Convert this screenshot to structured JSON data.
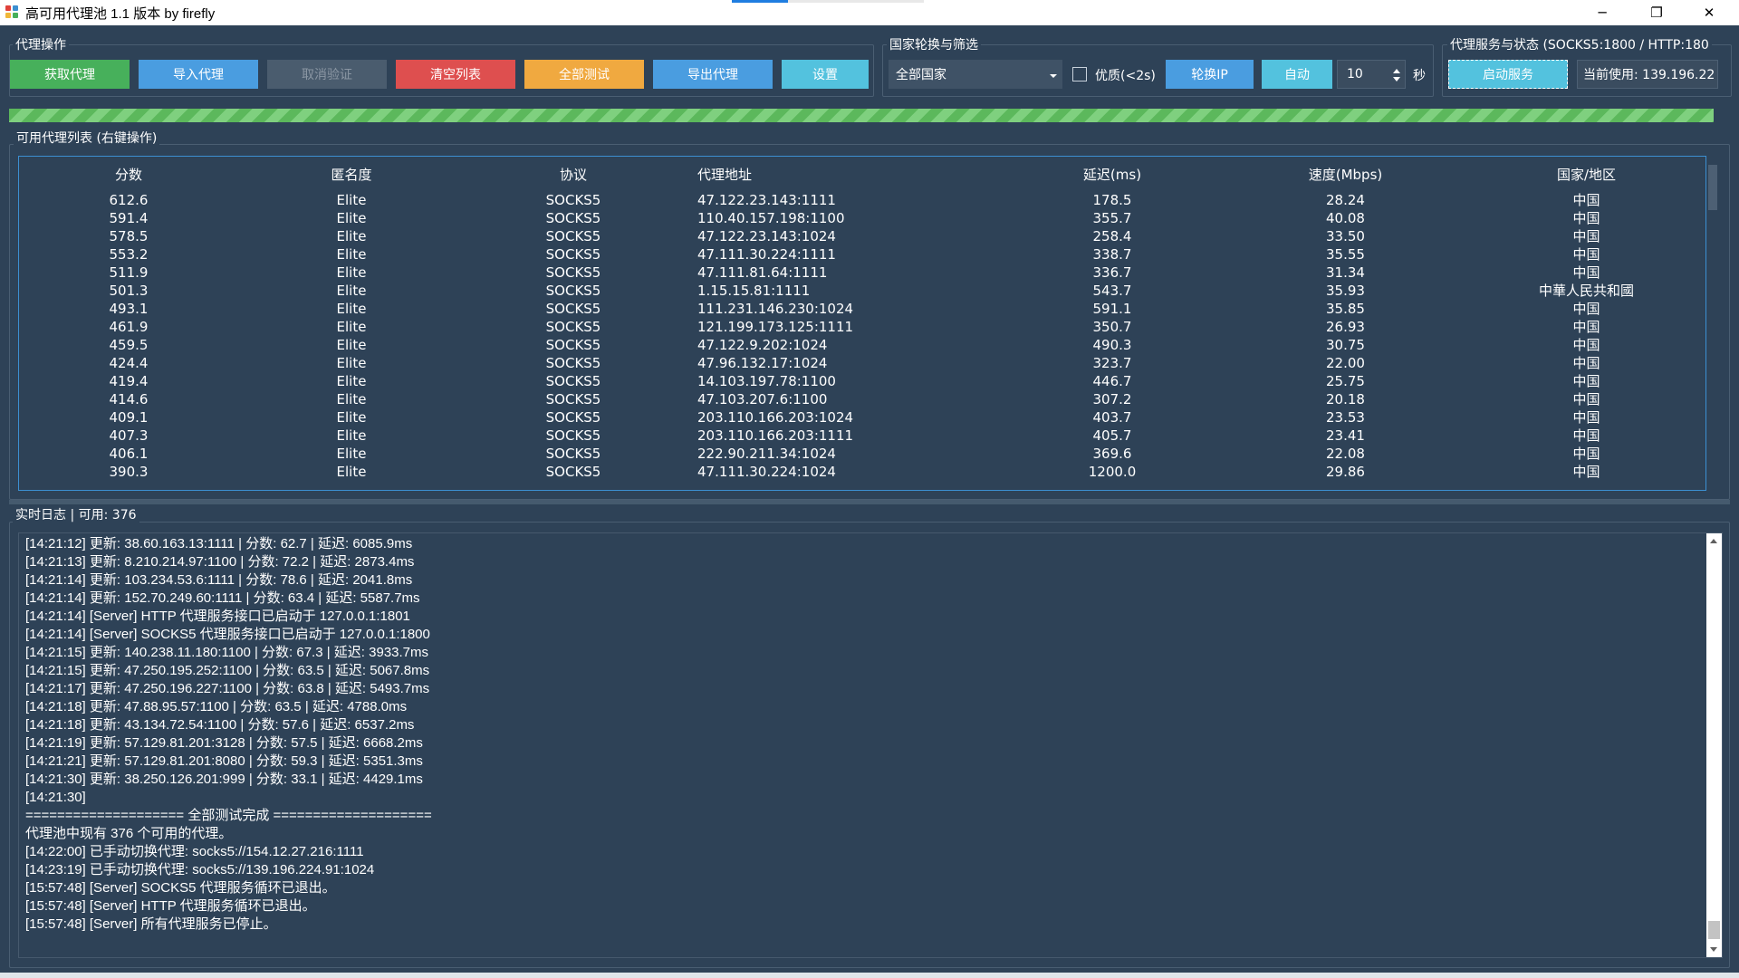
{
  "window": {
    "title": "高可用代理池 1.1 版本 by firefly",
    "minimize": "─",
    "restore": "❐",
    "close": "✕"
  },
  "proxy_ops": {
    "title": "代理操作",
    "buttons": [
      {
        "label": "获取代理",
        "color": "#47b05b"
      },
      {
        "label": "导入代理",
        "color": "#4a9de0"
      },
      {
        "label": "取消验证",
        "color": "#4a5c6e"
      },
      {
        "label": "清空列表",
        "color": "#de4f4f"
      },
      {
        "label": "全部测试",
        "color": "#f0a940"
      },
      {
        "label": "导出代理",
        "color": "#4a9de0"
      },
      {
        "label": "设置",
        "color": "#53c2de"
      }
    ]
  },
  "country": {
    "title": "国家轮换与筛选",
    "selected": "全部国家",
    "quality_label": "优质(<2s)",
    "rotate_label": "轮换IP",
    "auto_label": "自动",
    "interval_value": "10",
    "interval_unit": "秒"
  },
  "service": {
    "title": "代理服务与状态 (SOCKS5:1800 / HTTP:180",
    "start_label": "启动服务",
    "current_label": "当前使用: 139.196.22"
  },
  "progress": {
    "value_percent": 100
  },
  "proxy_table": {
    "title": "可用代理列表 (右键操作)",
    "columns": [
      "分数",
      "匿名度",
      "协议",
      "代理地址",
      "延迟(ms)",
      "速度(Mbps)",
      "国家/地区"
    ],
    "rows": [
      [
        "612.6",
        "Elite",
        "SOCKS5",
        "47.122.23.143:1111",
        "178.5",
        "28.24",
        "中国"
      ],
      [
        "591.4",
        "Elite",
        "SOCKS5",
        "110.40.157.198:1100",
        "355.7",
        "40.08",
        "中国"
      ],
      [
        "578.5",
        "Elite",
        "SOCKS5",
        "47.122.23.143:1024",
        "258.4",
        "33.50",
        "中国"
      ],
      [
        "553.2",
        "Elite",
        "SOCKS5",
        "47.111.30.224:1111",
        "338.7",
        "35.55",
        "中国"
      ],
      [
        "511.9",
        "Elite",
        "SOCKS5",
        "47.111.81.64:1111",
        "336.7",
        "31.34",
        "中国"
      ],
      [
        "501.3",
        "Elite",
        "SOCKS5",
        "1.15.15.81:1111",
        "543.7",
        "35.93",
        "中華人民共和國"
      ],
      [
        "493.1",
        "Elite",
        "SOCKS5",
        "111.231.146.230:1024",
        "591.1",
        "35.85",
        "中国"
      ],
      [
        "461.9",
        "Elite",
        "SOCKS5",
        "121.199.173.125:1111",
        "350.7",
        "26.93",
        "中国"
      ],
      [
        "459.5",
        "Elite",
        "SOCKS5",
        "47.122.9.202:1024",
        "490.3",
        "30.75",
        "中国"
      ],
      [
        "424.4",
        "Elite",
        "SOCKS5",
        "47.96.132.17:1024",
        "323.7",
        "22.00",
        "中国"
      ],
      [
        "419.4",
        "Elite",
        "SOCKS5",
        "14.103.197.78:1100",
        "446.7",
        "25.75",
        "中国"
      ],
      [
        "414.6",
        "Elite",
        "SOCKS5",
        "47.103.207.6:1100",
        "307.2",
        "20.18",
        "中国"
      ],
      [
        "409.1",
        "Elite",
        "SOCKS5",
        "203.110.166.203:1024",
        "403.7",
        "23.53",
        "中国"
      ],
      [
        "407.3",
        "Elite",
        "SOCKS5",
        "203.110.166.203:1111",
        "405.7",
        "23.41",
        "中国"
      ],
      [
        "406.1",
        "Elite",
        "SOCKS5",
        "222.90.211.34:1024",
        "369.6",
        "22.08",
        "中国"
      ],
      [
        "390.3",
        "Elite",
        "SOCKS5",
        "47.111.30.224:1024",
        "1200.0",
        "29.86",
        "中国"
      ]
    ]
  },
  "log": {
    "title": "实时日志 | 可用: 376",
    "lines": [
      "[14:21:12] 更新: 38.60.163.13:1111 | 分数: 62.7 | 延迟: 6085.9ms",
      "[14:21:13] 更新: 8.210.214.97:1100 | 分数: 72.2 | 延迟: 2873.4ms",
      "[14:21:14] 更新: 103.234.53.6:1111 | 分数: 78.6 | 延迟: 2041.8ms",
      "[14:21:14] 更新: 152.70.249.60:1111 | 分数: 63.4 | 延迟: 5587.7ms",
      "[14:21:14] [Server] HTTP 代理服务接口已启动于 127.0.0.1:1801",
      "[14:21:14] [Server] SOCKS5 代理服务接口已启动于 127.0.0.1:1800",
      "[14:21:15] 更新: 140.238.11.180:1100 | 分数: 67.3 | 延迟: 3933.7ms",
      "[14:21:15] 更新: 47.250.195.252:1100 | 分数: 63.5 | 延迟: 5067.8ms",
      "[14:21:17] 更新: 47.250.196.227:1100 | 分数: 63.8 | 延迟: 5493.7ms",
      "[14:21:18] 更新: 47.88.95.57:1100 | 分数: 63.5 | 延迟: 4788.0ms",
      "[14:21:18] 更新: 43.134.72.54:1100 | 分数: 57.6 | 延迟: 6537.2ms",
      "[14:21:19] 更新: 57.129.81.201:3128 | 分数: 57.5 | 延迟: 6668.2ms",
      "[14:21:21] 更新: 57.129.81.201:8080 | 分数: 59.3 | 延迟: 5351.3ms",
      "[14:21:30] 更新: 38.250.126.201:999 | 分数: 33.1 | 延迟: 4429.1ms",
      "[14:21:30]",
      "==================== 全部测试完成 ====================",
      "代理池中现有 376 个可用的代理。",
      "[14:22:00] 已手动切换代理: socks5://154.12.27.216:1111",
      "[14:23:19] 已手动切换代理: socks5://139.196.224.91:1024",
      "[15:57:48] [Server] SOCKS5 代理服务循环已退出。",
      "[15:57:48] [Server] HTTP 代理服务循环已退出。",
      "[15:57:48] [Server] 所有代理服务已停止。"
    ]
  }
}
